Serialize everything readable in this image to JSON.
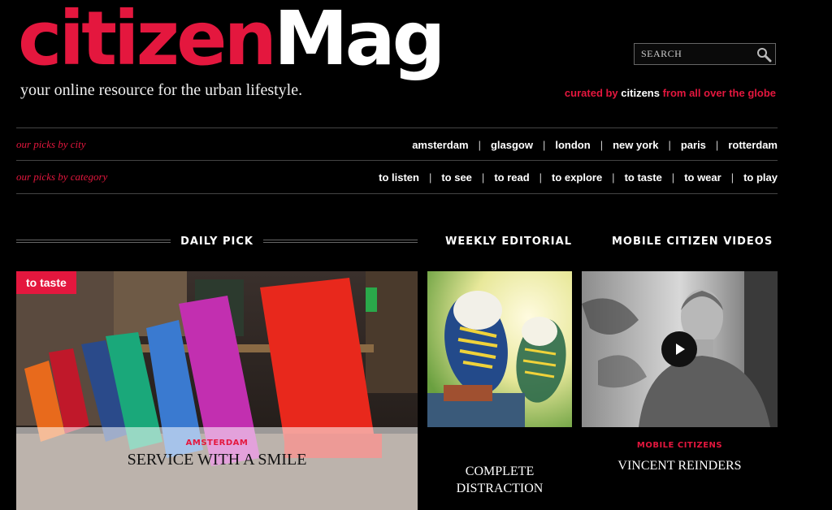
{
  "brand": {
    "logo_part1": "citizen",
    "logo_part2": "Mag",
    "tagline": "your online resource for the urban lifestyle.",
    "accent": "#e4173e"
  },
  "search": {
    "placeholder": "SEARCH",
    "icon": "search-icon"
  },
  "curated": {
    "before": "curated by ",
    "highlight": "citizens",
    "after": " from all over the globe"
  },
  "nav_city": {
    "label": "our picks by city",
    "items": [
      "amsterdam",
      "glasgow",
      "london",
      "new york",
      "paris",
      "rotterdam"
    ]
  },
  "nav_category": {
    "label": "our picks by category",
    "items": [
      "to listen",
      "to see",
      "to read",
      "to explore",
      "to taste",
      "to wear",
      "to play"
    ]
  },
  "sections": {
    "daily": "DAILY PICK",
    "weekly": "WEEKLY EDITORIAL",
    "videos": "MOBILE CITIZEN VIDEOS"
  },
  "daily_pick": {
    "tag": "to taste",
    "kicker": "AMSTERDAM",
    "title": "SERVICE WITH A SMILE"
  },
  "weekly_editorial": {
    "title_line1": "COMPLETE",
    "title_line2": "DISTRACTION"
  },
  "video": {
    "kicker": "MOBILE CITIZENS",
    "title": "VINCENT REINDERS",
    "icon": "play-icon"
  }
}
